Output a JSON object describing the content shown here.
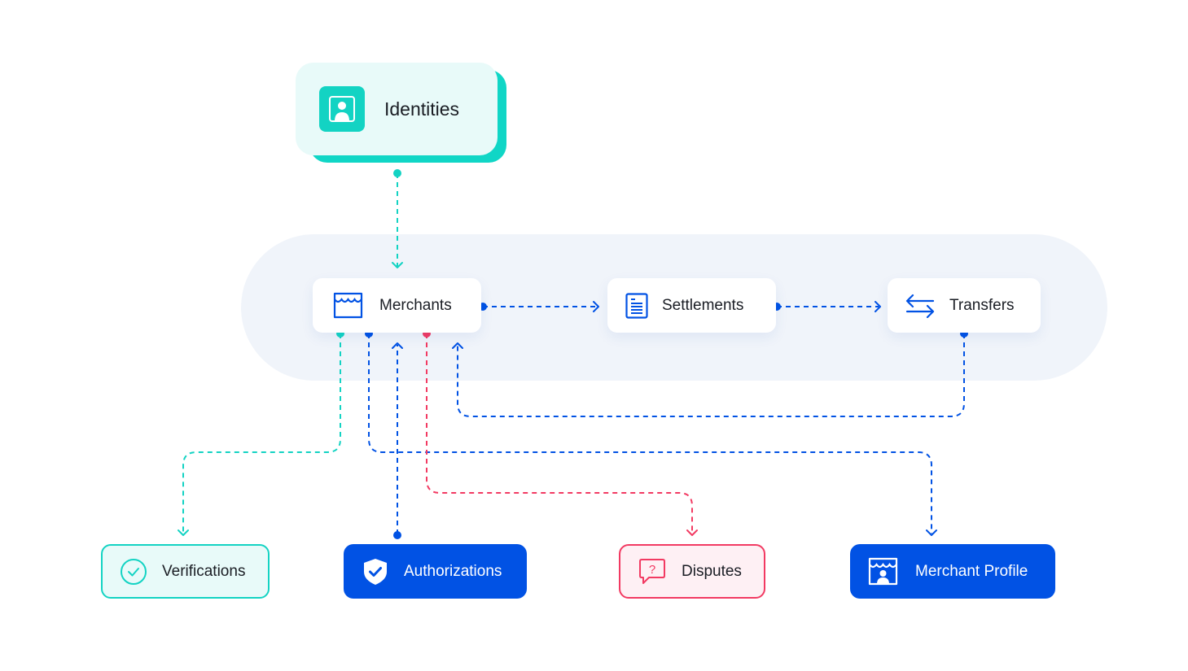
{
  "colors": {
    "teal": "#13d3c3",
    "blue": "#0152e4",
    "red": "#f23a62",
    "pill_background": "#f0f4fa",
    "teal_tint": "#e8faf9",
    "red_tint": "#fef0f4"
  },
  "source": {
    "label": "Identities",
    "icon": "identity-card-icon"
  },
  "core_flow": [
    {
      "label": "Merchants",
      "icon": "storefront-icon"
    },
    {
      "label": "Settlements",
      "icon": "document-icon"
    },
    {
      "label": "Transfers",
      "icon": "transfer-arrows-icon"
    }
  ],
  "outputs": [
    {
      "label": "Verifications",
      "icon": "check-circle-icon",
      "style": "teal-outline"
    },
    {
      "label": "Authorizations",
      "icon": "shield-check-icon",
      "style": "blue-filled"
    },
    {
      "label": "Disputes",
      "icon": "question-bubble-icon",
      "style": "red-outline"
    },
    {
      "label": "Merchant Profile",
      "icon": "storefront-person-icon",
      "style": "blue-filled"
    }
  ],
  "connections": [
    {
      "from": "Identities",
      "to": "Merchants",
      "color": "teal"
    },
    {
      "from": "Merchants",
      "to": "Settlements",
      "color": "blue"
    },
    {
      "from": "Settlements",
      "to": "Transfers",
      "color": "blue"
    },
    {
      "from": "Transfers",
      "to": "Merchants",
      "color": "blue"
    },
    {
      "from": "Merchants",
      "to": "Verifications",
      "color": "teal"
    },
    {
      "from": "Authorizations",
      "to": "Merchants",
      "color": "blue"
    },
    {
      "from": "Merchants",
      "to": "Disputes",
      "color": "red"
    },
    {
      "from": "Merchants",
      "to": "Merchant Profile",
      "color": "blue"
    }
  ]
}
